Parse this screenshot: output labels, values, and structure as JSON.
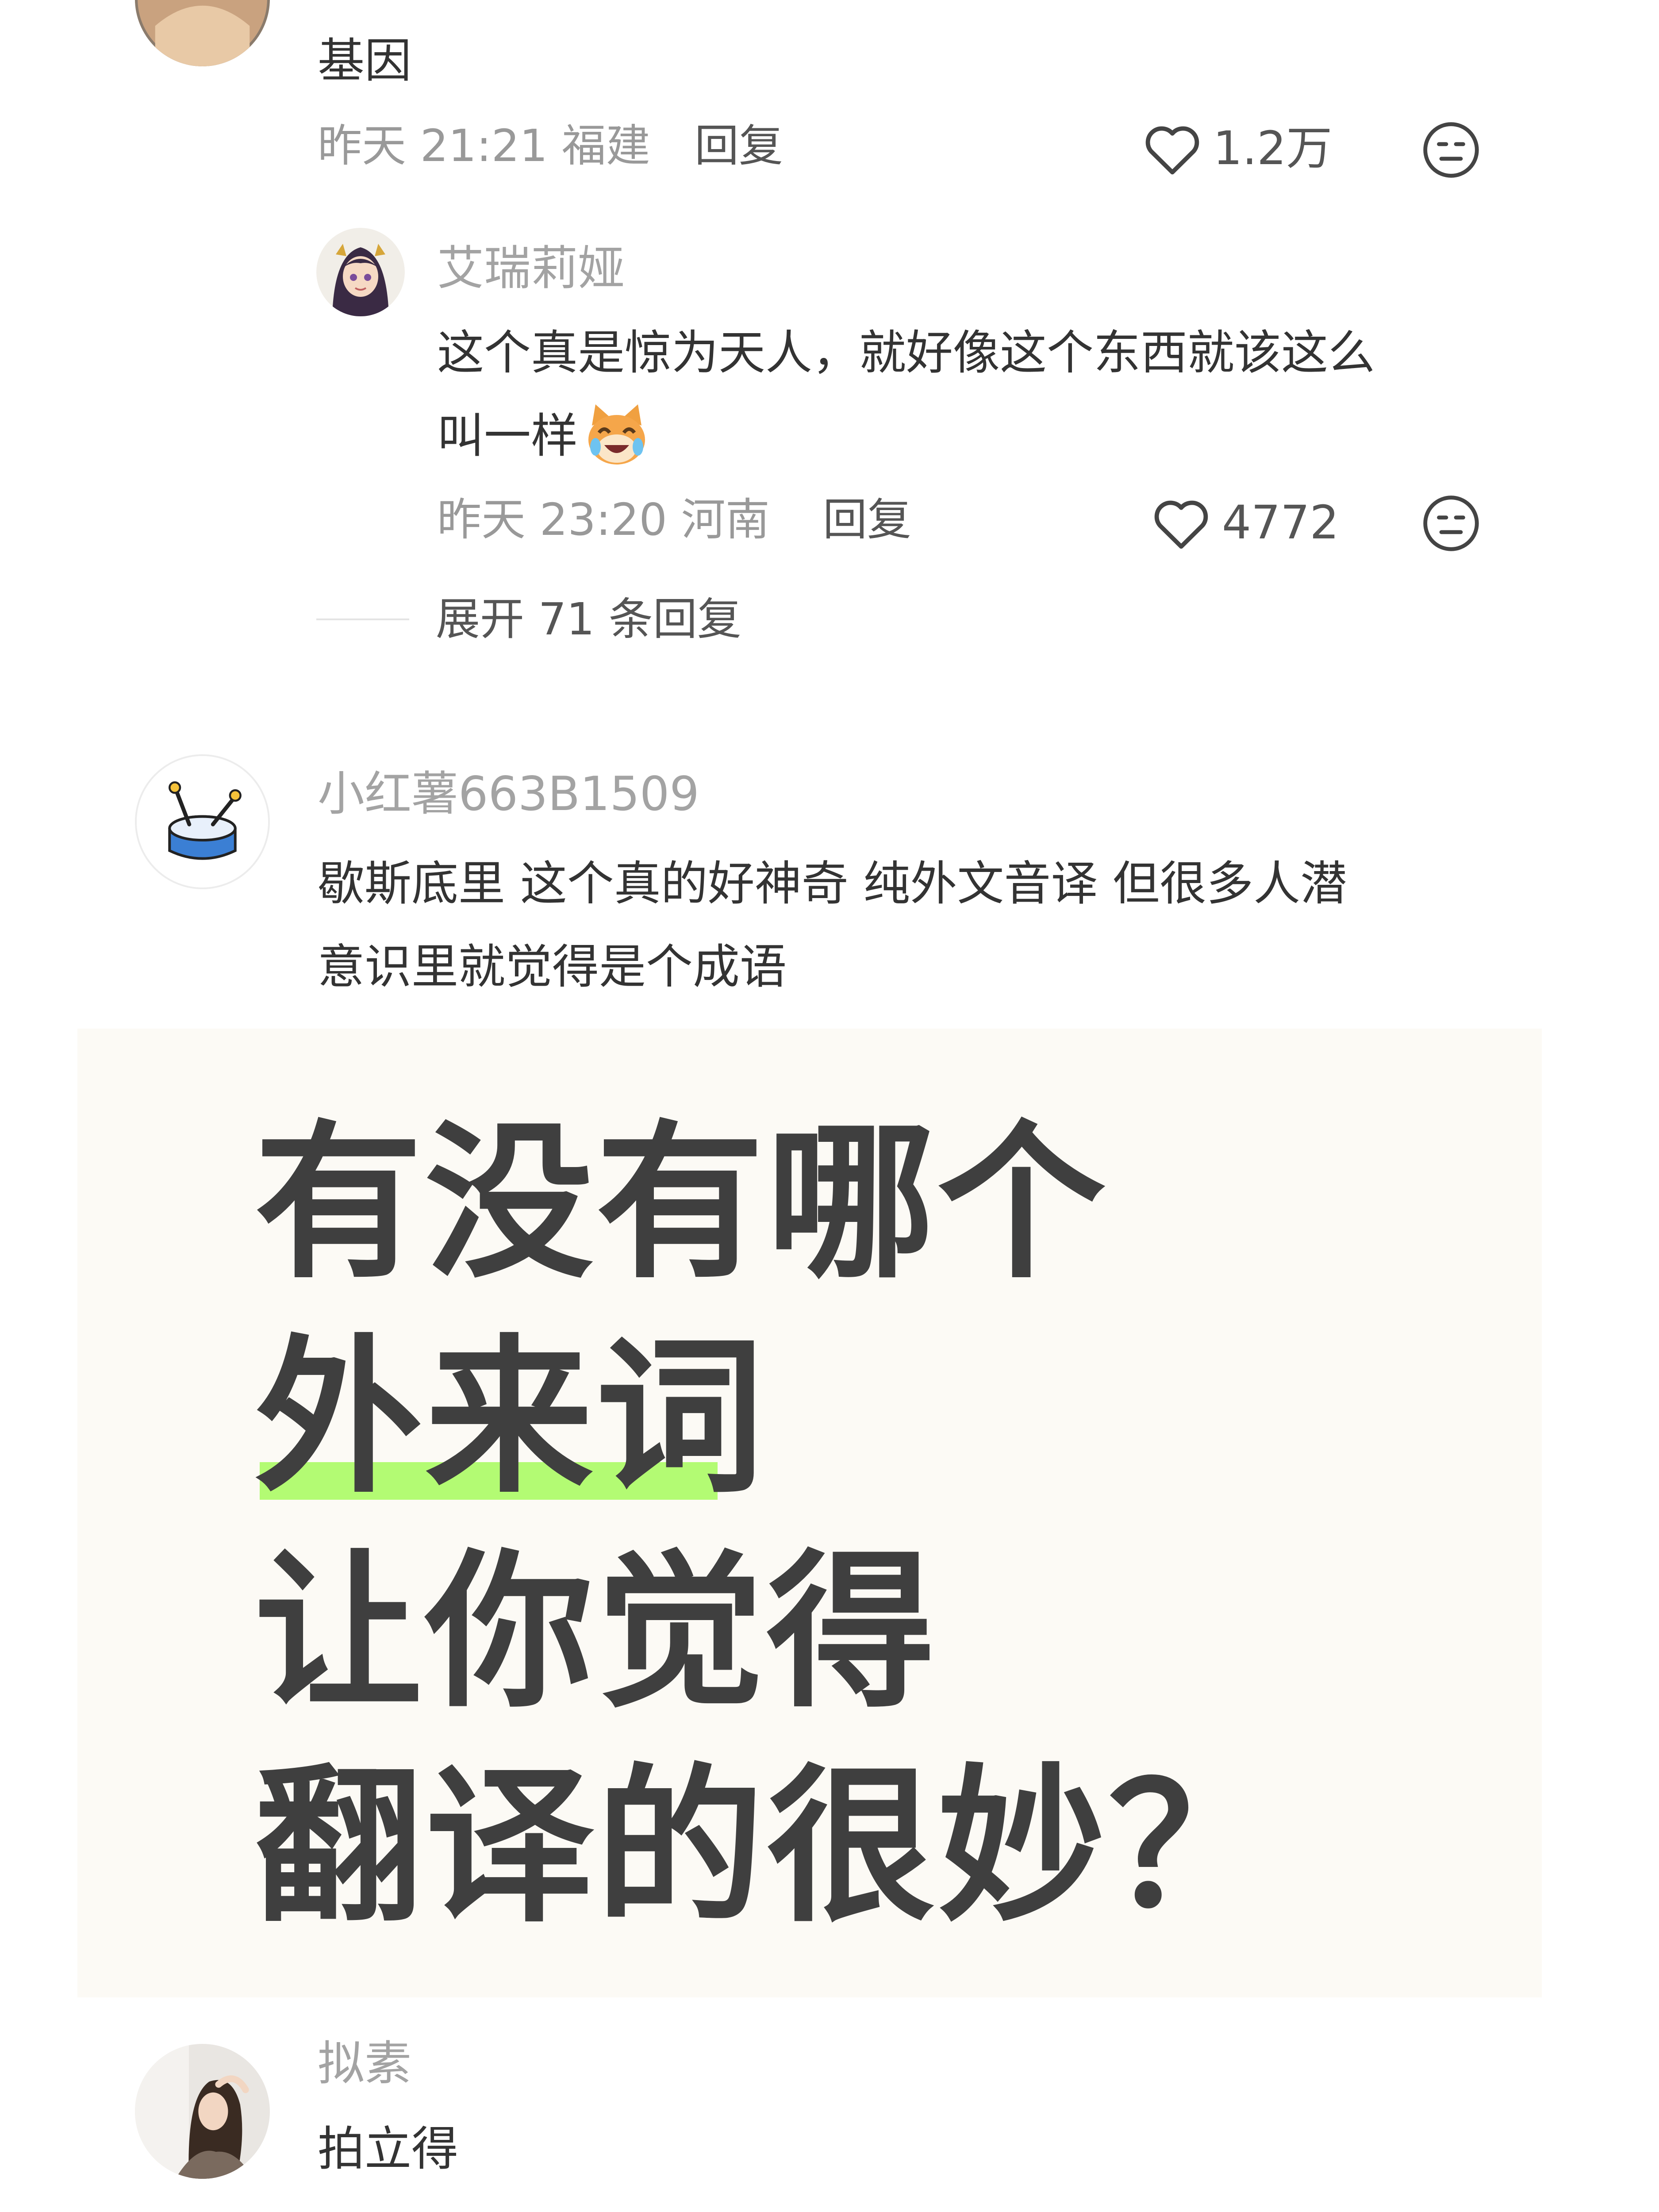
{
  "comments": [
    {
      "text": "基因",
      "time": "昨天 21:21 福建",
      "reply_label": "回复",
      "likes": "1.2万",
      "replies": [
        {
          "username": "艾瑞莉娅",
          "text_lines": [
            "这个真是惊为天人，就好像这个东西就该这么",
            "叫一样"
          ],
          "time": "昨天 23:20 河南",
          "reply_label": "回复",
          "likes": "4772"
        }
      ],
      "expand_label": "展开 71 条回复"
    },
    {
      "username": "小红薯663B1509",
      "text_lines": [
        "歇斯底里 这个真的好神奇 纯外文音译 但很多人潜",
        "意识里就觉得是个成语"
      ],
      "image": {
        "lines": [
          "有没有哪个",
          "外来词",
          "让你觉得",
          "翻译的很妙？"
        ],
        "highlight_color": "#b3fb73"
      }
    },
    {
      "username": "拟素",
      "text": "拍立得"
    }
  ],
  "icons": {
    "like": "heart-outline-icon",
    "dislike": "neutral-face-icon",
    "emoji": "laughing-cat-emoji"
  },
  "colors": {
    "primary_text": "#333333",
    "secondary_text": "#999999",
    "image_background": "#fcfaf5",
    "highlight": "#b3fb73"
  }
}
